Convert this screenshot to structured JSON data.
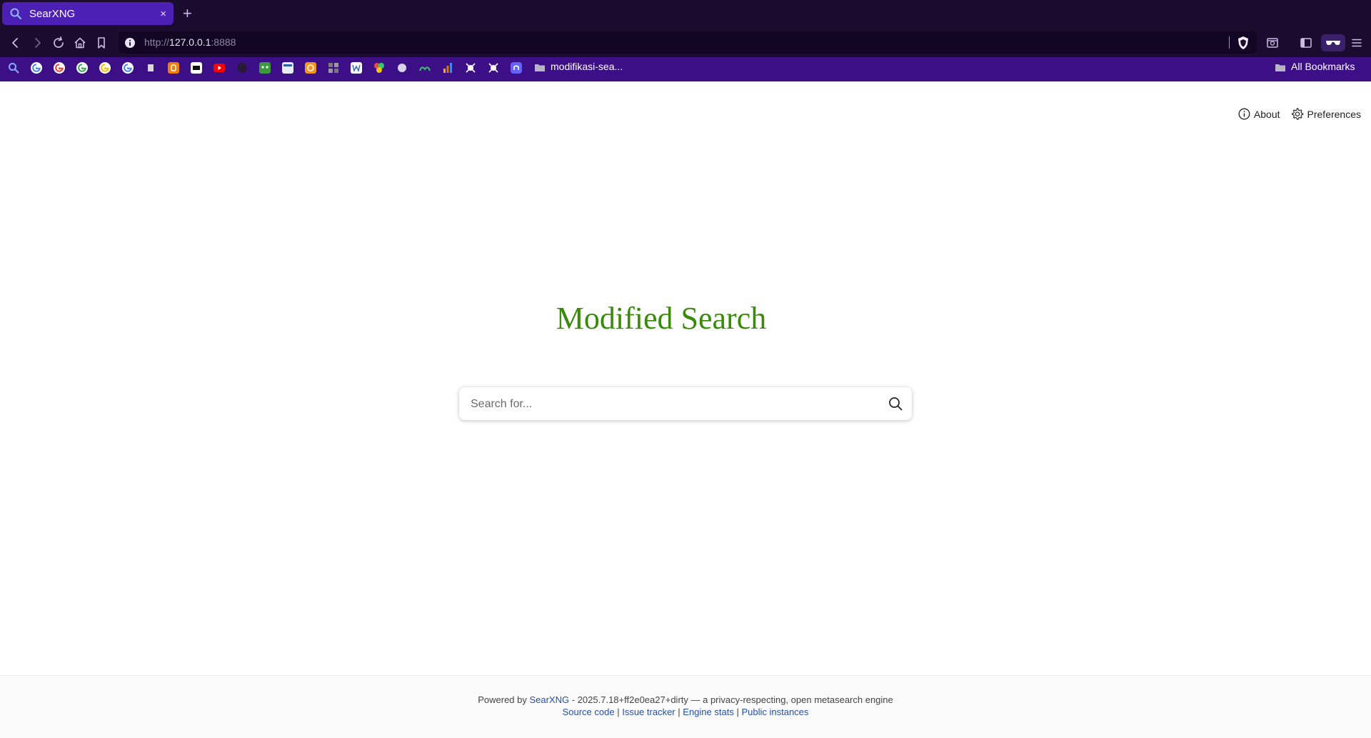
{
  "browser": {
    "tab_title": "SearXNG",
    "tab_close": "×",
    "new_tab": "+",
    "url_scheme": "http://",
    "url_host": "127.0.0.1",
    "url_port": ":8888",
    "bookmarks_folder_label": "modifikasi-sea...",
    "all_bookmarks_label": "All Bookmarks"
  },
  "page": {
    "nav": {
      "about_label": "About",
      "preferences_label": "Preferences"
    },
    "logo_title": "Modified Search",
    "search_placeholder": "Search for...",
    "footer": {
      "powered_by": "Powered by",
      "searxng_link": "SearXNG",
      "version_text": "- 2025.7.18+ff2e0ea27+dirty — a privacy-respecting, open metasearch engine",
      "source_code": "Source code",
      "issue_tracker": "Issue tracker",
      "engine_stats": "Engine stats",
      "public_instances": "Public instances",
      "separator": "|"
    }
  },
  "colors": {
    "title_green": "#3a8a0b",
    "link_blue": "#2550a8",
    "tab_active": "#4c1fb5",
    "bookmarks_bar": "#3d0f86",
    "chrome_dark": "#1b0b2e"
  }
}
